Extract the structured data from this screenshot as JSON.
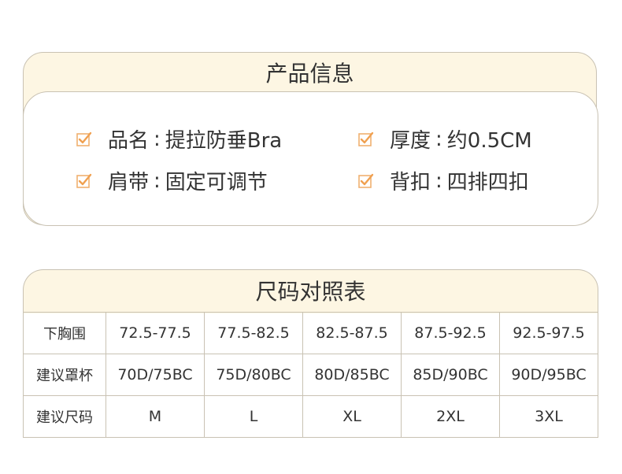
{
  "product_info": {
    "title": "产品信息",
    "items": [
      {
        "label": "品名",
        "sep": ":",
        "value": "提拉防垂Bra"
      },
      {
        "label": "厚度",
        "sep": ":",
        "value": "约0.5CM"
      },
      {
        "label": "肩带",
        "sep": ":",
        "value": "固定可调节"
      },
      {
        "label": "背扣",
        "sep": ":",
        "value": "四排四扣"
      }
    ],
    "check_icon": "checkbox-checked-icon"
  },
  "size_chart": {
    "title": "尺码对照表",
    "rows": [
      {
        "header": "下胸围",
        "cells": [
          "72.5-77.5",
          "77.5-82.5",
          "82.5-87.5",
          "87.5-92.5",
          "92.5-97.5"
        ]
      },
      {
        "header": "建议罩杯",
        "cells": [
          "70D/75BC",
          "75D/80BC",
          "80D/85BC",
          "85D/90BC",
          "90D/95BC"
        ]
      },
      {
        "header": "建议尺码",
        "cells": [
          "M",
          "L",
          "XL",
          "2XL",
          "3XL"
        ]
      }
    ]
  },
  "colors": {
    "cream": "#fdf6e3",
    "border": "#c9c2b3",
    "check_orange": "#f0a860",
    "text": "#333333"
  }
}
